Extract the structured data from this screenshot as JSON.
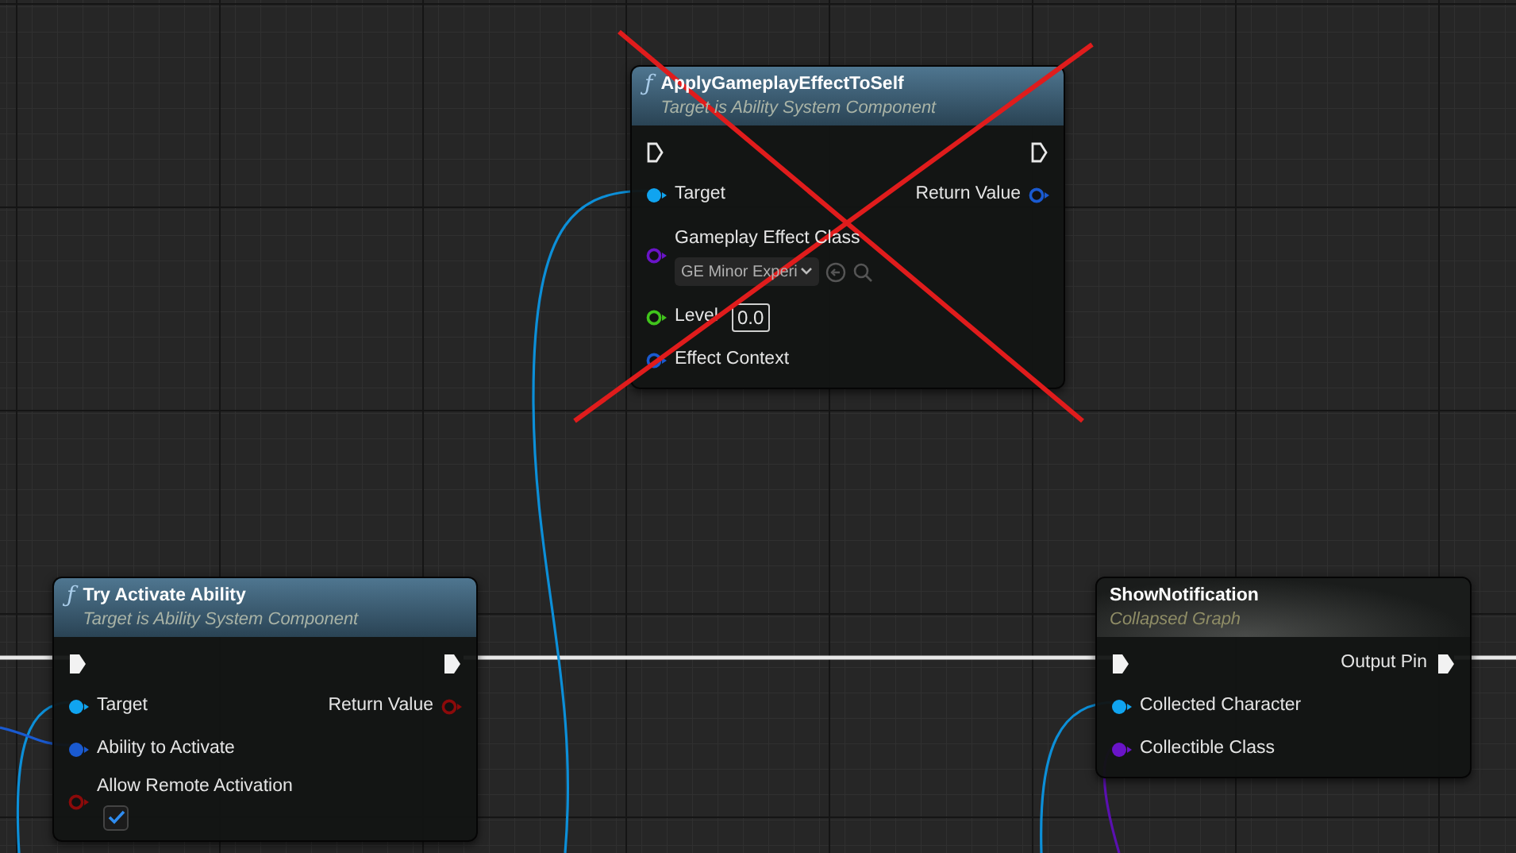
{
  "nodes": [
    {
      "kind": "function",
      "icon_glyph": "ƒ",
      "title": "ApplyGameplayEffectToSelf",
      "subtitle": "Target is Ability System Component",
      "crossed_out": true,
      "exec_in": {
        "connected": false
      },
      "exec_out": {
        "connected": false
      },
      "inputs": [
        {
          "label": "Target",
          "color": "#10a4f0",
          "connected": true
        },
        {
          "label": "Gameplay Effect Class",
          "color": "#6a14c8",
          "connected": false,
          "widget": {
            "kind": "dropdown",
            "value": "GE Minor Experi"
          }
        },
        {
          "label": "Level",
          "color": "#40c41c",
          "connected": false,
          "widget": {
            "kind": "number",
            "value": "0.0"
          }
        },
        {
          "label": "Effect Context",
          "color": "#1a5ad0",
          "connected": false
        }
      ],
      "outputs": [
        {
          "label": "Return Value",
          "color": "#1a5ad0",
          "connected": false
        }
      ]
    },
    {
      "kind": "function",
      "icon_glyph": "ƒ",
      "title": "Try Activate Ability",
      "subtitle": "Target is Ability System Component",
      "crossed_out": false,
      "exec_in": {
        "connected": true
      },
      "exec_out": {
        "connected": true
      },
      "inputs": [
        {
          "label": "Target",
          "color": "#10a4f0",
          "connected": true
        },
        {
          "label": "Ability to Activate",
          "color": "#1a5ad0",
          "connected": true
        },
        {
          "label": "Allow Remote Activation",
          "color": "#8c0a0a",
          "connected": false,
          "widget": {
            "kind": "checkbox",
            "checked": true
          }
        }
      ],
      "outputs": [
        {
          "label": "Return Value",
          "color": "#8c0a0a",
          "connected": false
        }
      ]
    },
    {
      "kind": "collapsed",
      "title": "ShowNotification",
      "subtitle": "Collapsed Graph",
      "crossed_out": false,
      "exec_in": {
        "connected": true
      },
      "exec_out": {
        "connected": true,
        "label": "Output Pin"
      },
      "inputs": [
        {
          "label": "Collected Character",
          "color": "#10a4f0",
          "connected": true
        },
        {
          "label": "Collectible Class",
          "color": "#6a14c8",
          "connected": true
        }
      ]
    }
  ]
}
